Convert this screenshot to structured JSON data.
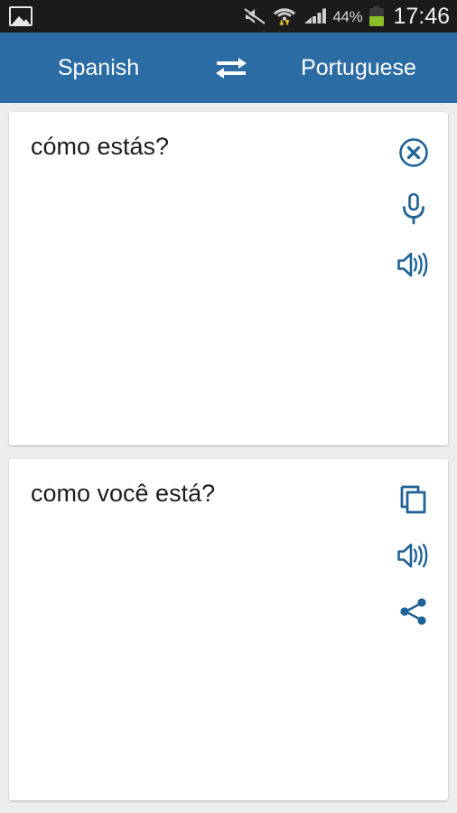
{
  "status_bar": {
    "notification_icon": "photo-icon",
    "icons": [
      "sound-muted-icon",
      "wifi-data-transfer-icon",
      "cellular-signal-icon"
    ],
    "battery_percent": "44%",
    "battery_icon": "battery-icon",
    "clock": "17:46"
  },
  "header": {
    "source_language": "Spanish",
    "target_language": "Portuguese",
    "swap_icon": "swap-languages-icon",
    "background_color": "#2a6ca3"
  },
  "source_card": {
    "text": "cómo estás?",
    "actions": [
      {
        "name": "clear-button",
        "icon": "clear-circle-icon"
      },
      {
        "name": "microphone-button",
        "icon": "microphone-icon"
      },
      {
        "name": "speak-source-button",
        "icon": "speaker-icon"
      }
    ]
  },
  "target_card": {
    "text": "como você está?",
    "actions": [
      {
        "name": "copy-button",
        "icon": "copy-icon"
      },
      {
        "name": "speak-target-button",
        "icon": "speaker-icon"
      },
      {
        "name": "share-button",
        "icon": "share-icon"
      }
    ]
  },
  "theme": {
    "accent_color": "#1f6296",
    "page_background": "#eceeee",
    "card_background": "#ffffff",
    "text_color": "#1c1c1c"
  }
}
